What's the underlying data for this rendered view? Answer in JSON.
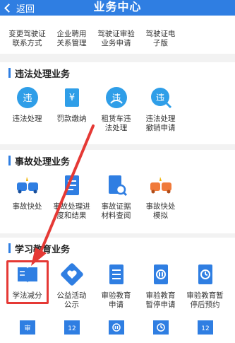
{
  "header": {
    "back_label": "返回",
    "title": "业务中心"
  },
  "top_row": [
    {
      "label": "变更驾驶证\n联系方式",
      "icon": "license-contact-icon"
    },
    {
      "label": "企业聘用\n关系管理",
      "icon": "company-icon"
    },
    {
      "label": "驾驶证审验\n业务申请",
      "icon": "license-review-icon"
    },
    {
      "label": "驾驶证电\n子版",
      "icon": "e-license-icon"
    }
  ],
  "violations": {
    "title": "违法处理业务",
    "items": [
      {
        "label": "违法处理",
        "icon": "violation-icon",
        "glyph": "违",
        "color": "#2f9ee8"
      },
      {
        "label": "罚款缴纳",
        "icon": "fine-payment-icon",
        "glyph": "¥",
        "color": "#2f9ee8"
      },
      {
        "label": "租赁车违\n法处理",
        "icon": "rental-violation-icon",
        "glyph": "违",
        "color": "#2f9ee8"
      },
      {
        "label": "违法处理\n撤销申请",
        "icon": "violation-cancel-icon",
        "glyph": "违",
        "color": "#2f9ee8"
      }
    ]
  },
  "accidents": {
    "title": "事故处理业务",
    "items": [
      {
        "label": "事故快处",
        "icon": "accident-quick-icon",
        "color": "#2f7ee2"
      },
      {
        "label": "事故处理进\n度和结果",
        "icon": "accident-progress-icon",
        "color": "#2f7ee2"
      },
      {
        "label": "事故证据\n材料查阅",
        "icon": "accident-evidence-icon",
        "color": "#2f7ee2"
      },
      {
        "label": "事故快处\n模拟",
        "icon": "accident-simulation-icon",
        "color": "#f07a3a"
      }
    ]
  },
  "learning": {
    "title": "学习教育业务",
    "items": [
      {
        "label": "学法减分",
        "icon": "study-book-icon"
      },
      {
        "label": "公益活动\n公示",
        "icon": "charity-icon"
      },
      {
        "label": "审验教育\n申请",
        "icon": "review-education-icon"
      },
      {
        "label": "审验教育\n暂停申请",
        "icon": "review-pause-icon"
      },
      {
        "label": "审验教育暂\n停后预约",
        "icon": "review-appointment-icon"
      }
    ],
    "bottom_icons": [
      {
        "icon": "teacher-icon",
        "glyph": "审"
      },
      {
        "icon": "calendar-12-icon",
        "glyph": "12"
      },
      {
        "icon": "pause-circle-icon",
        "glyph": "‖"
      },
      {
        "icon": "clock-icon",
        "glyph": "◷"
      },
      {
        "icon": "board-12-icon",
        "glyph": "12"
      }
    ]
  }
}
